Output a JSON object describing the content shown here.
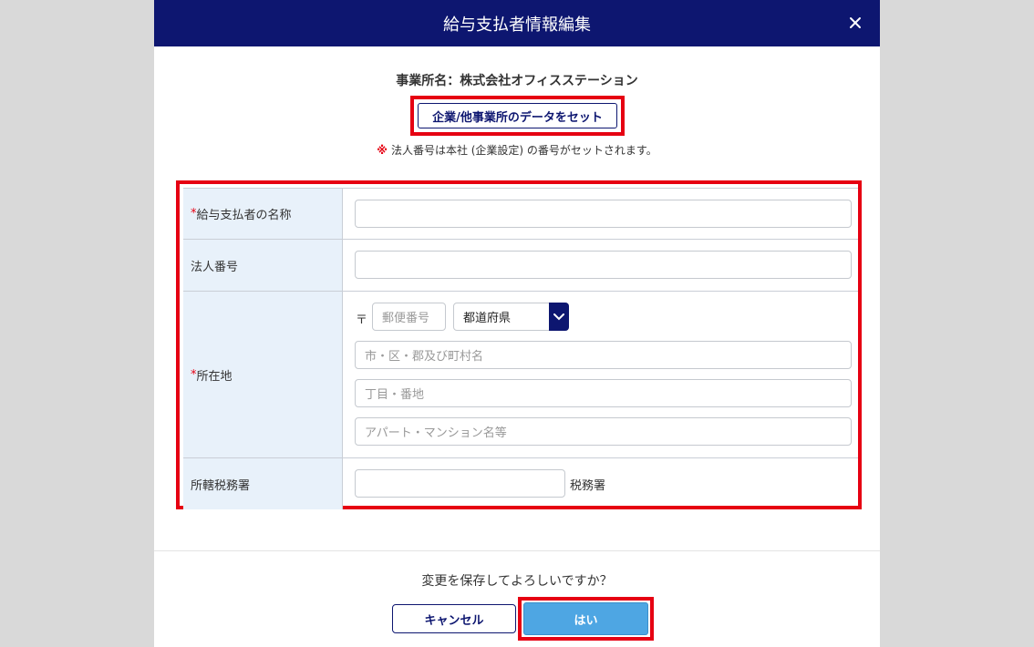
{
  "dialog": {
    "title": "給与支払者情報編集",
    "office_name": "事業所名：株式会社オフィスステーション",
    "set_button_label": "企業/他事業所のデータをセット",
    "note_mark": "※",
    "note_text": "法人番号は本社 (企業設定) の番号がセットされます。"
  },
  "form": {
    "required_mark": "*",
    "payer_name_label": "給与支払者の名称",
    "corporate_number_label": "法人番号",
    "address_label": "所在地",
    "zip_mark": "〒",
    "zip_placeholder": "郵便番号",
    "prefecture_value": "都道府県",
    "city_placeholder": "市・区・郡及び町村名",
    "block_placeholder": "丁目・番地",
    "building_placeholder": "アパート・マンション名等",
    "tax_office_label": "所轄税務署",
    "tax_office_suffix": "税務署"
  },
  "footer": {
    "confirm_text": "変更を保存してよろしいですか？",
    "cancel_label": "キャンセル",
    "yes_label": "はい"
  },
  "colors": {
    "header_bg": "#0d1670",
    "highlight": "#e60012",
    "label_bg": "#e8f1fa",
    "primary_button": "#4ea6e3"
  },
  "icons": {
    "close": "close-icon",
    "dropdown": "chevron-down-icon"
  }
}
